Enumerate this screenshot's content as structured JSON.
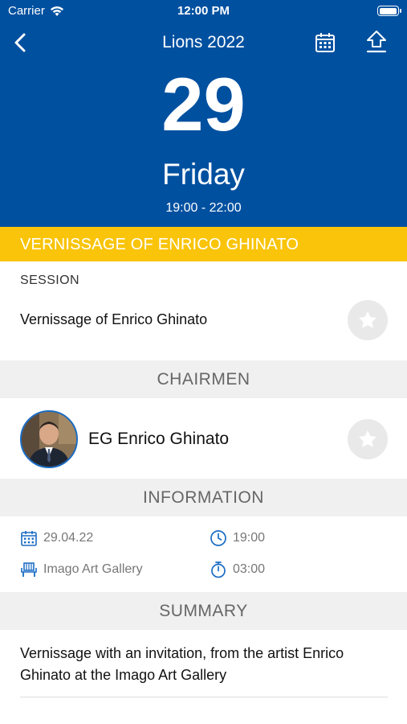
{
  "status_bar": {
    "carrier": "Carrier",
    "time": "12:00 PM",
    "battery_level": 1.0
  },
  "nav": {
    "title": "Lions 2022",
    "icons": {
      "back": "back-chevron-icon",
      "calendar": "calendar-icon",
      "share": "share-upload-icon"
    }
  },
  "event": {
    "day_number": "29",
    "day_name": "Friday",
    "time_range": "19:00 - 22:00",
    "title": "VERNISSAGE OF ENRICO GHINATO"
  },
  "session": {
    "label": "SESSION",
    "name": "Vernissage of Enrico Ghinato"
  },
  "chairmen": {
    "header": "CHAIRMEN",
    "items": [
      {
        "name": "EG Enrico Ghinato"
      }
    ]
  },
  "information": {
    "header": "INFORMATION",
    "date": "29.04.22",
    "start_time": "19:00",
    "location": "Imago Art Gallery",
    "duration": "03:00"
  },
  "summary": {
    "header": "SUMMARY",
    "text": "Vernissage with an invitation, from the artist Enrico Ghinato at the Imago Art Gallery"
  },
  "colors": {
    "header_blue": "#0050a0",
    "accent_yellow": "#f9c40a",
    "icon_blue": "#1a6cc4",
    "section_bg": "#f0f0f0"
  }
}
